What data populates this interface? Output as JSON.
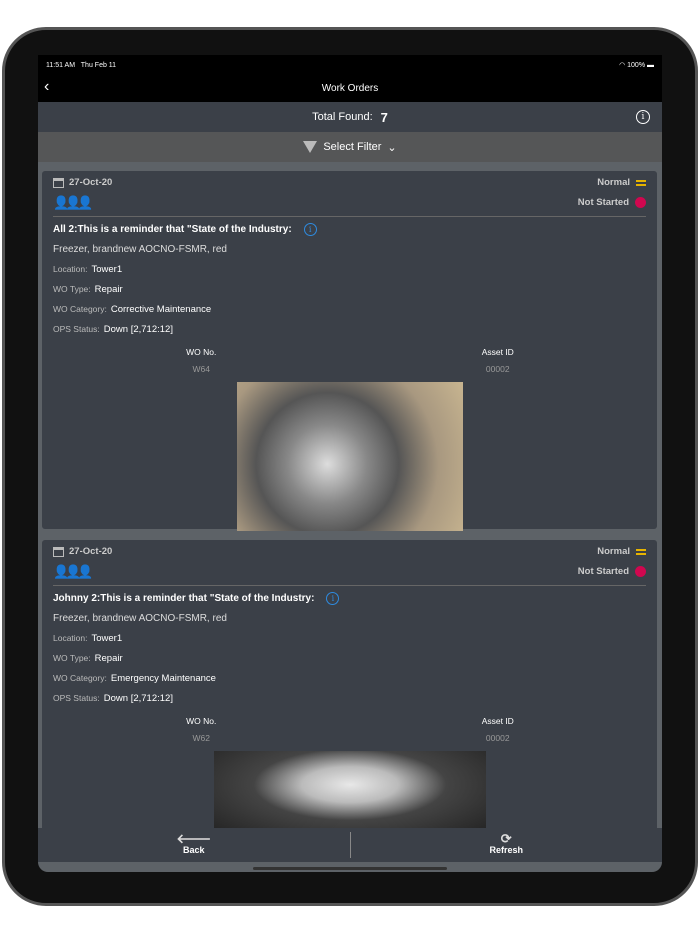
{
  "status": {
    "time": "11:51 AM",
    "date": "Thu Feb 11",
    "battery": "100%"
  },
  "nav": {
    "title": "Work Orders"
  },
  "summary": {
    "label": "Total Found:",
    "count": "7"
  },
  "filter": {
    "label": "Select Filter"
  },
  "orders": [
    {
      "date": "27-Oct-20",
      "priority": "Normal",
      "status": "Not Started",
      "title": "All 2:This is a reminder that \"State of the Industry:",
      "asset": "Freezer, brandnew AOCNO-FSMR, red",
      "location_label": "Location:",
      "location": "Tower1",
      "type_label": "WO Type:",
      "type": "Repair",
      "category_label": "WO Category:",
      "category": "Corrective Maintenance",
      "ops_label": "OPS Status:",
      "ops": "Down [2,712:12]",
      "wo_label": "WO No.",
      "wo": "W64",
      "asset_id_label": "Asset ID",
      "asset_id": "00002"
    },
    {
      "date": "27-Oct-20",
      "priority": "Normal",
      "status": "Not Started",
      "title": "Johnny 2:This is a reminder that \"State of the Industry:",
      "asset": "Freezer, brandnew AOCNO-FSMR, red",
      "location_label": "Location:",
      "location": "Tower1",
      "type_label": "WO Type:",
      "type": "Repair",
      "category_label": "WO Category:",
      "category": "Emergency Maintenance",
      "ops_label": "OPS Status:",
      "ops": "Down [2,712:12]",
      "wo_label": "WO No.",
      "wo": "W62",
      "asset_id_label": "Asset ID",
      "asset_id": "00002"
    }
  ],
  "toolbar": {
    "back": "Back",
    "refresh": "Refresh"
  }
}
